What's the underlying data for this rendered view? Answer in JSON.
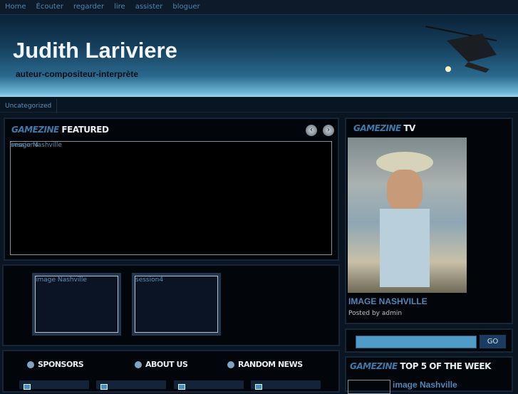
{
  "nav": [
    "Home",
    "Écouter",
    "regarder",
    "lire",
    "assister",
    "bloguer"
  ],
  "header": {
    "title": "Judith Lariviere",
    "subtitle": "auteur-compositeur-interprète"
  },
  "categories": [
    "Uncategorized"
  ],
  "featured": {
    "title_a": "GAMEZINE",
    "title_b": "FEATURED",
    "slides": [
      "image Nashville",
      "session4"
    ],
    "prev": "‹",
    "next": "›"
  },
  "thumbs": [
    "image Nashville",
    "session4"
  ],
  "tv": {
    "title_a": "GAMEZINE",
    "title_b": "TV",
    "post_title": "IMAGE NASHVILLE",
    "posted": "Posted by admin"
  },
  "search": {
    "value": "",
    "button": "GO"
  },
  "top5": {
    "title_a": "GAMEZINE",
    "title_b": "TOP 5 OF THE WEEK",
    "items": [
      "image Nashville"
    ]
  },
  "footer": {
    "headings": [
      "SPONSORS",
      "ABOUT US",
      "RANDOM NEWS"
    ]
  }
}
